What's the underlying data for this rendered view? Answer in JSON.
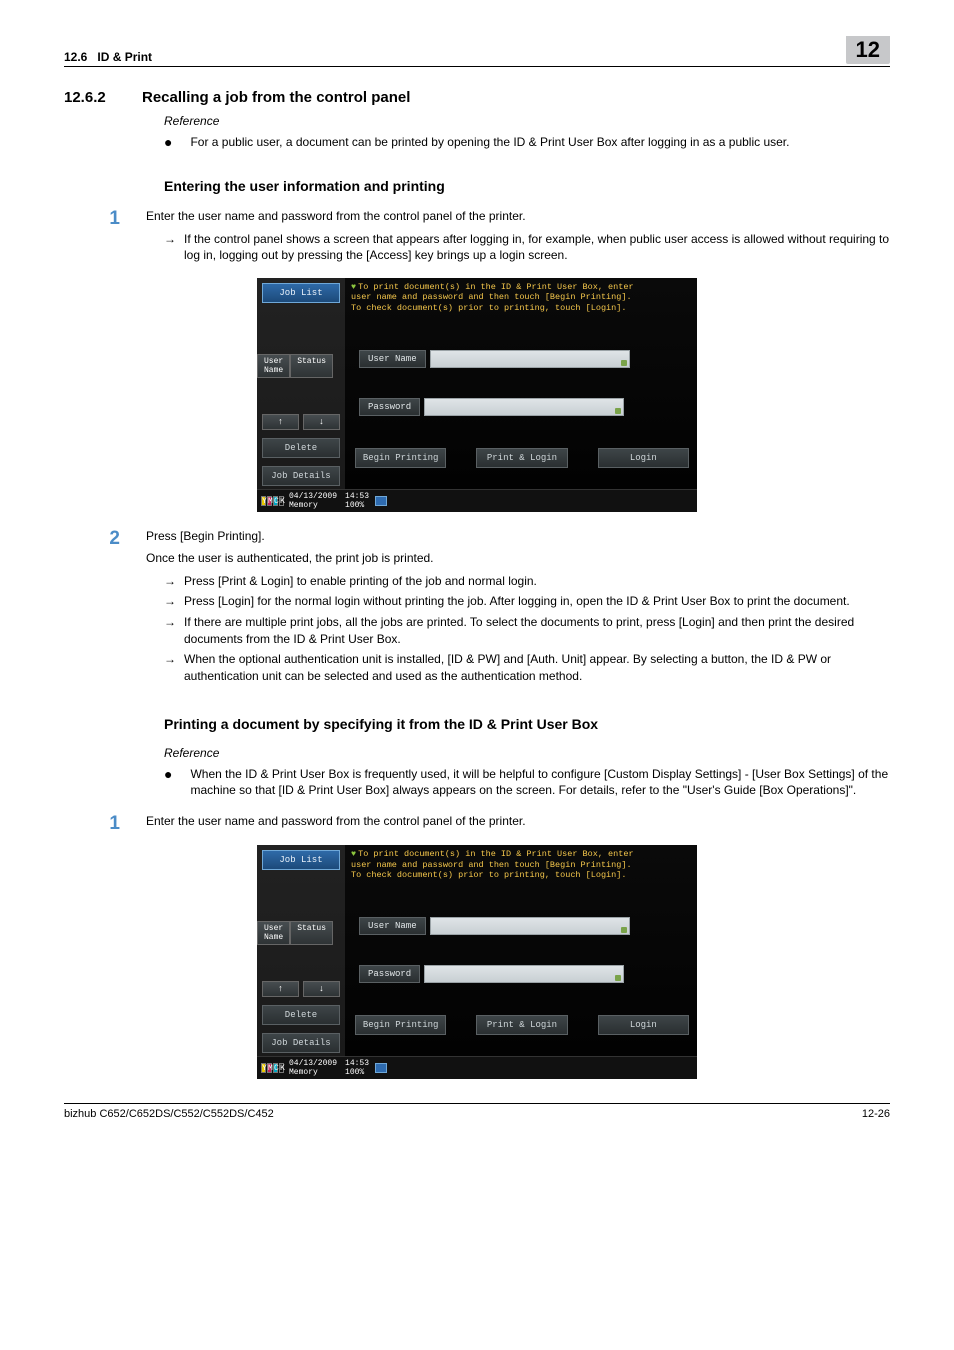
{
  "running_head": {
    "section_no": "12.6",
    "section_title": "ID & Print",
    "chapter_no": "12"
  },
  "section": {
    "num": "12.6.2",
    "title": "Recalling a job from the control panel",
    "ref_label": "Reference",
    "ref_bullet": "For a public user, a document can be printed by opening the ID & Print User Box after logging in as a public user."
  },
  "sub1": {
    "heading": "Entering the user information and printing",
    "step1_text": "Enter the user name and password from the control panel of the printer.",
    "step1_arrow1": "If the control panel shows a screen that appears after logging in, for example, when public user access is allowed without requiring to log in, logging out by pressing the [Access] key brings up a login screen.",
    "step2_text": "Press [Begin Printing].",
    "step2_after": "Once the user is authenticated, the print job is printed.",
    "step2_arrows": [
      "Press [Print & Login] to enable printing of the job and normal login.",
      "Press [Login] for the normal login without printing the job. After logging in, open the ID & Print User Box to print the document.",
      "If there are multiple print jobs, all the jobs are printed. To select the documents to print, press [Login] and then print the desired documents from the ID & Print User Box.",
      "When the optional authentication unit is installed, [ID & PW] and [Auth. Unit] appear. By selecting a button, the ID & PW or authentication unit can be selected and used as the authentication method."
    ]
  },
  "sub2": {
    "heading": "Printing a document by specifying it from the ID & Print User Box",
    "ref_label": "Reference",
    "ref_bullet": "When the ID & Print User Box is frequently used, it will be helpful to configure [Custom Display Settings] - [User Box Settings] of the machine so that [ID & Print User Box] always appears on the screen. For details, refer to the \"User's Guide [Box Operations]\".",
    "step1_text": "Enter the user name and password from the control panel of the printer."
  },
  "panel": {
    "job_list": "Job List",
    "user_name_col": "User\nName",
    "status_tab": "Status",
    "up": "↑",
    "down": "↓",
    "delete": "Delete",
    "job_details": "Job Details",
    "message_line1": "To print document(s) in the ID & Print User Box, enter",
    "message_line2": "user name and password and then touch [Begin Printing].",
    "message_line3": "To check document(s) prior to printing, touch [Login].",
    "field_user": "User Name",
    "field_pass": "Password",
    "begin_printing": "Begin Printing",
    "print_login": "Print & Login",
    "login": "Login",
    "date": "04/13/2009",
    "time": "14:53",
    "memory_label": "Memory",
    "memory_val": "100%",
    "ink_y": "Y",
    "ink_m": "M",
    "ink_c": "C",
    "ink_k": "K"
  },
  "footer": {
    "left": "bizhub C652/C652DS/C552/C552DS/C452",
    "right": "12-26"
  }
}
